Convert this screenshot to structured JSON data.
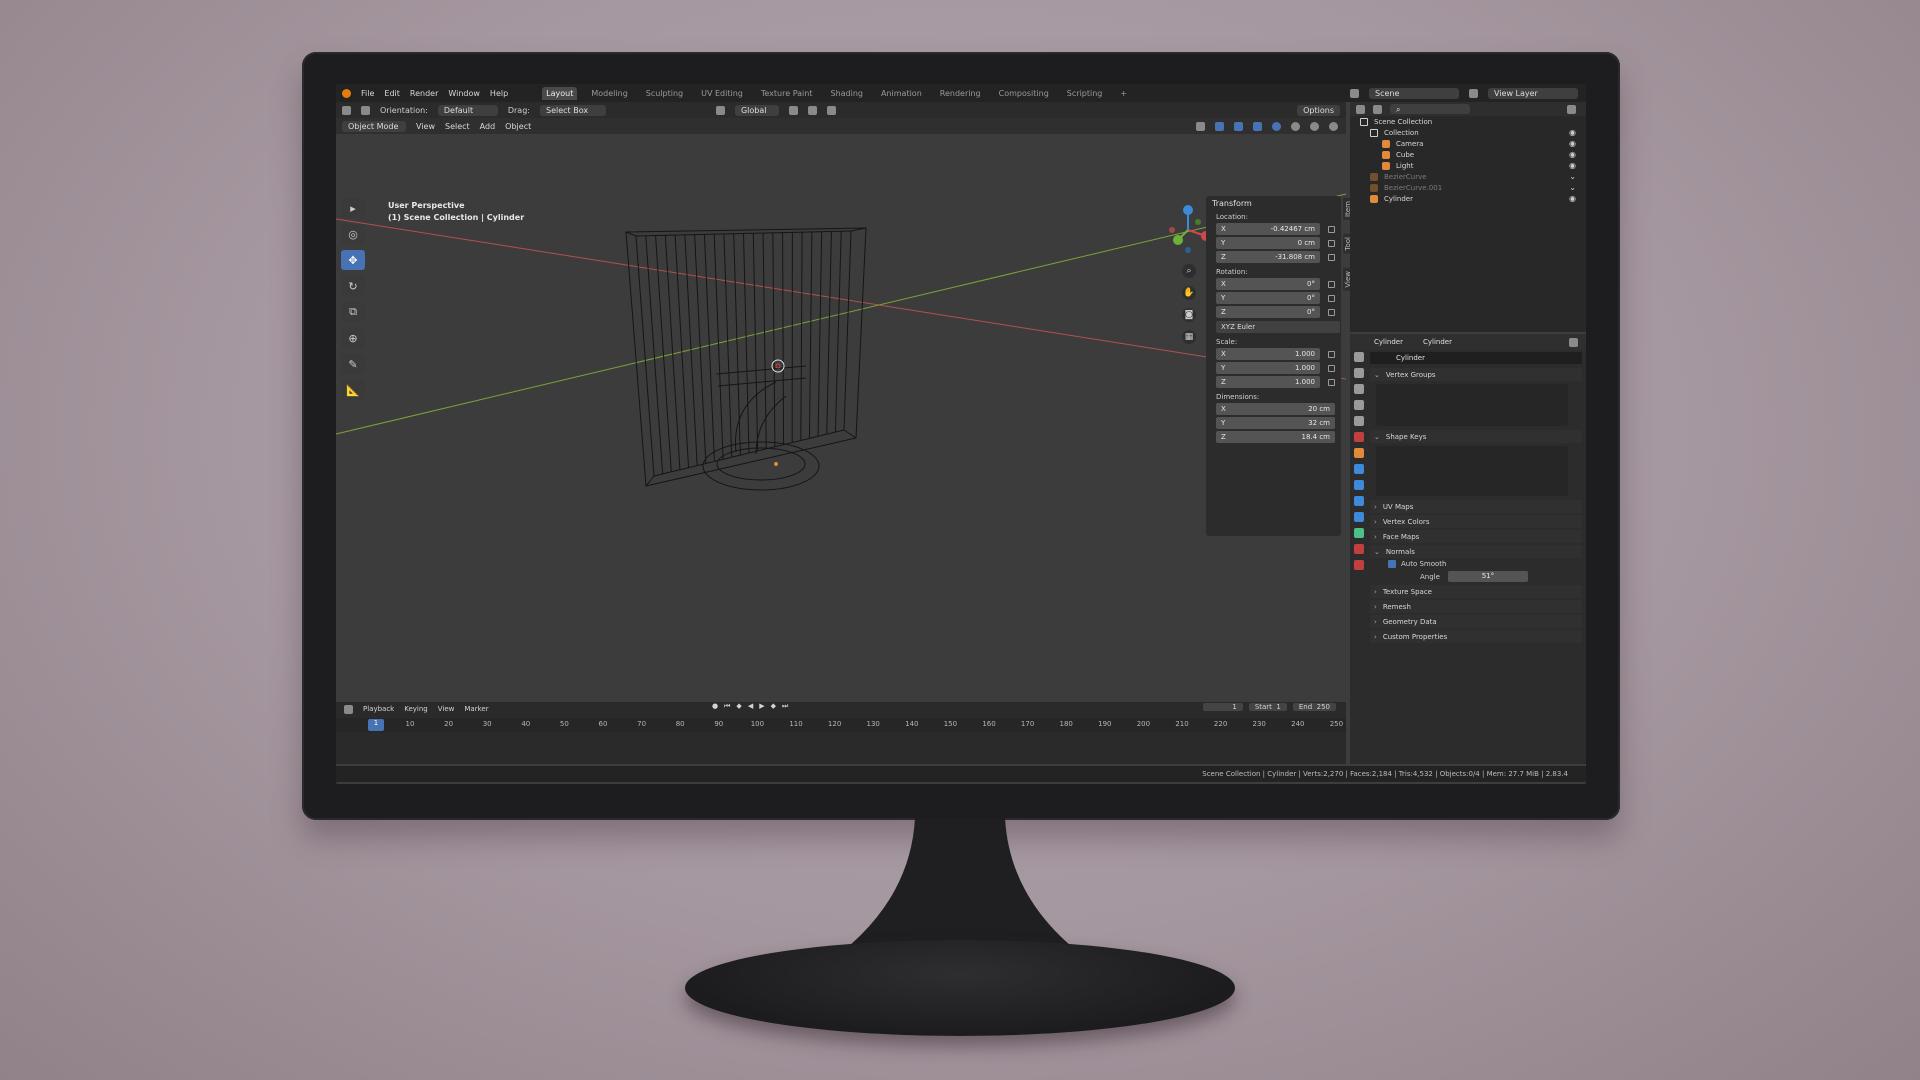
{
  "topbar": {
    "menus": [
      "File",
      "Edit",
      "Render",
      "Window",
      "Help"
    ],
    "workspaces": [
      "Layout",
      "Modeling",
      "Sculpting",
      "UV Editing",
      "Texture Paint",
      "Shading",
      "Animation",
      "Rendering",
      "Compositing",
      "Scripting"
    ],
    "add_tab": "+",
    "scene": "Scene",
    "view_layer": "View Layer"
  },
  "toolheader": {
    "orientation_label": "Orientation:",
    "orientation_value": "Default",
    "drag_label": "Drag:",
    "drag_value": "Select Box",
    "transform_orientation": "Global",
    "options": "Options"
  },
  "viewheader": {
    "mode": "Object Mode",
    "menus": [
      "View",
      "Select",
      "Add",
      "Object"
    ]
  },
  "viewport": {
    "perspective": "User Perspective",
    "collection_path": "(1) Scene Collection | Cylinder"
  },
  "npanel": {
    "title": "Transform",
    "location_label": "Location:",
    "location": [
      [
        "X",
        "-0.42467 cm"
      ],
      [
        "Y",
        "0 cm"
      ],
      [
        "Z",
        "-31.808 cm"
      ]
    ],
    "rotation_label": "Rotation:",
    "rotation": [
      [
        "X",
        "0°"
      ],
      [
        "Y",
        "0°"
      ],
      [
        "Z",
        "0°"
      ]
    ],
    "rotation_mode": "XYZ Euler",
    "scale_label": "Scale:",
    "scale": [
      [
        "X",
        "1.000"
      ],
      [
        "Y",
        "1.000"
      ],
      [
        "Z",
        "1.000"
      ]
    ],
    "dimensions_label": "Dimensions:",
    "dimensions": [
      [
        "X",
        "20 cm"
      ],
      [
        "Y",
        "32 cm"
      ],
      [
        "Z",
        "18.4 cm"
      ]
    ],
    "side_tabs": [
      "Item",
      "Tool",
      "View"
    ]
  },
  "outliner": {
    "root": "Scene Collection",
    "collection": "Collection",
    "items": [
      {
        "name": "Camera",
        "faded": false
      },
      {
        "name": "Cube",
        "faded": false
      },
      {
        "name": "Light",
        "faded": false
      },
      {
        "name": "BezierCurve",
        "faded": true
      },
      {
        "name": "BezierCurve.001",
        "faded": true
      },
      {
        "name": "Cylinder",
        "faded": false
      }
    ]
  },
  "properties": {
    "object_name": "Cylinder",
    "mesh_name": "Cylinder",
    "data_name": "Cylinder",
    "panels": {
      "vertex_groups": "Vertex Groups",
      "shape_keys": "Shape Keys",
      "uv_maps": "UV Maps",
      "vertex_colors": "Vertex Colors",
      "face_maps": "Face Maps",
      "normals": "Normals",
      "auto_smooth": "Auto Smooth",
      "angle_label": "Angle",
      "angle_value": "51°",
      "texture_space": "Texture Space",
      "remesh": "Remesh",
      "geometry_data": "Geometry Data",
      "custom_properties": "Custom Properties"
    }
  },
  "timeline": {
    "menus": [
      "Playback",
      "Keying",
      "View",
      "Marker"
    ],
    "current_frame": "1",
    "start_label": "Start",
    "start": "1",
    "end_label": "End",
    "end": "250",
    "ticks": [
      "10",
      "20",
      "30",
      "40",
      "50",
      "60",
      "70",
      "80",
      "90",
      "100",
      "110",
      "120",
      "130",
      "140",
      "150",
      "160",
      "170",
      "180",
      "190",
      "200",
      "210",
      "220",
      "230",
      "240",
      "250"
    ]
  },
  "statusbar": {
    "text": "Scene Collection | Cylinder | Verts:2,270 | Faces:2,184 | Tris:4,532 | Objects:0/4 | Mem: 27.7 MiB | 2.83.4"
  },
  "colors": {
    "accent": "#4772b3",
    "x_axis": "#c45454",
    "y_axis": "#7ca33a",
    "object_orange": "#e08a3a",
    "mesh_green": "#4fbf8a"
  }
}
